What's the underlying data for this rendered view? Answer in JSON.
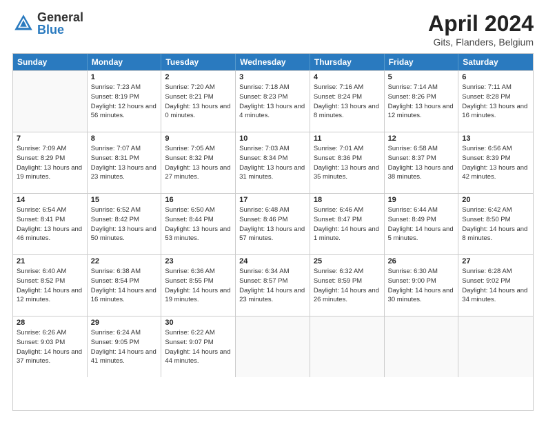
{
  "logo": {
    "general": "General",
    "blue": "Blue"
  },
  "header": {
    "month": "April 2024",
    "location": "Gits, Flanders, Belgium"
  },
  "days": [
    "Sunday",
    "Monday",
    "Tuesday",
    "Wednesday",
    "Thursday",
    "Friday",
    "Saturday"
  ],
  "weeks": [
    [
      {
        "day": "",
        "sunrise": "",
        "sunset": "",
        "daylight": ""
      },
      {
        "day": "1",
        "sunrise": "Sunrise: 7:23 AM",
        "sunset": "Sunset: 8:19 PM",
        "daylight": "Daylight: 12 hours and 56 minutes."
      },
      {
        "day": "2",
        "sunrise": "Sunrise: 7:20 AM",
        "sunset": "Sunset: 8:21 PM",
        "daylight": "Daylight: 13 hours and 0 minutes."
      },
      {
        "day": "3",
        "sunrise": "Sunrise: 7:18 AM",
        "sunset": "Sunset: 8:23 PM",
        "daylight": "Daylight: 13 hours and 4 minutes."
      },
      {
        "day": "4",
        "sunrise": "Sunrise: 7:16 AM",
        "sunset": "Sunset: 8:24 PM",
        "daylight": "Daylight: 13 hours and 8 minutes."
      },
      {
        "day": "5",
        "sunrise": "Sunrise: 7:14 AM",
        "sunset": "Sunset: 8:26 PM",
        "daylight": "Daylight: 13 hours and 12 minutes."
      },
      {
        "day": "6",
        "sunrise": "Sunrise: 7:11 AM",
        "sunset": "Sunset: 8:28 PM",
        "daylight": "Daylight: 13 hours and 16 minutes."
      }
    ],
    [
      {
        "day": "7",
        "sunrise": "Sunrise: 7:09 AM",
        "sunset": "Sunset: 8:29 PM",
        "daylight": "Daylight: 13 hours and 19 minutes."
      },
      {
        "day": "8",
        "sunrise": "Sunrise: 7:07 AM",
        "sunset": "Sunset: 8:31 PM",
        "daylight": "Daylight: 13 hours and 23 minutes."
      },
      {
        "day": "9",
        "sunrise": "Sunrise: 7:05 AM",
        "sunset": "Sunset: 8:32 PM",
        "daylight": "Daylight: 13 hours and 27 minutes."
      },
      {
        "day": "10",
        "sunrise": "Sunrise: 7:03 AM",
        "sunset": "Sunset: 8:34 PM",
        "daylight": "Daylight: 13 hours and 31 minutes."
      },
      {
        "day": "11",
        "sunrise": "Sunrise: 7:01 AM",
        "sunset": "Sunset: 8:36 PM",
        "daylight": "Daylight: 13 hours and 35 minutes."
      },
      {
        "day": "12",
        "sunrise": "Sunrise: 6:58 AM",
        "sunset": "Sunset: 8:37 PM",
        "daylight": "Daylight: 13 hours and 38 minutes."
      },
      {
        "day": "13",
        "sunrise": "Sunrise: 6:56 AM",
        "sunset": "Sunset: 8:39 PM",
        "daylight": "Daylight: 13 hours and 42 minutes."
      }
    ],
    [
      {
        "day": "14",
        "sunrise": "Sunrise: 6:54 AM",
        "sunset": "Sunset: 8:41 PM",
        "daylight": "Daylight: 13 hours and 46 minutes."
      },
      {
        "day": "15",
        "sunrise": "Sunrise: 6:52 AM",
        "sunset": "Sunset: 8:42 PM",
        "daylight": "Daylight: 13 hours and 50 minutes."
      },
      {
        "day": "16",
        "sunrise": "Sunrise: 6:50 AM",
        "sunset": "Sunset: 8:44 PM",
        "daylight": "Daylight: 13 hours and 53 minutes."
      },
      {
        "day": "17",
        "sunrise": "Sunrise: 6:48 AM",
        "sunset": "Sunset: 8:46 PM",
        "daylight": "Daylight: 13 hours and 57 minutes."
      },
      {
        "day": "18",
        "sunrise": "Sunrise: 6:46 AM",
        "sunset": "Sunset: 8:47 PM",
        "daylight": "Daylight: 14 hours and 1 minute."
      },
      {
        "day": "19",
        "sunrise": "Sunrise: 6:44 AM",
        "sunset": "Sunset: 8:49 PM",
        "daylight": "Daylight: 14 hours and 5 minutes."
      },
      {
        "day": "20",
        "sunrise": "Sunrise: 6:42 AM",
        "sunset": "Sunset: 8:50 PM",
        "daylight": "Daylight: 14 hours and 8 minutes."
      }
    ],
    [
      {
        "day": "21",
        "sunrise": "Sunrise: 6:40 AM",
        "sunset": "Sunset: 8:52 PM",
        "daylight": "Daylight: 14 hours and 12 minutes."
      },
      {
        "day": "22",
        "sunrise": "Sunrise: 6:38 AM",
        "sunset": "Sunset: 8:54 PM",
        "daylight": "Daylight: 14 hours and 16 minutes."
      },
      {
        "day": "23",
        "sunrise": "Sunrise: 6:36 AM",
        "sunset": "Sunset: 8:55 PM",
        "daylight": "Daylight: 14 hours and 19 minutes."
      },
      {
        "day": "24",
        "sunrise": "Sunrise: 6:34 AM",
        "sunset": "Sunset: 8:57 PM",
        "daylight": "Daylight: 14 hours and 23 minutes."
      },
      {
        "day": "25",
        "sunrise": "Sunrise: 6:32 AM",
        "sunset": "Sunset: 8:59 PM",
        "daylight": "Daylight: 14 hours and 26 minutes."
      },
      {
        "day": "26",
        "sunrise": "Sunrise: 6:30 AM",
        "sunset": "Sunset: 9:00 PM",
        "daylight": "Daylight: 14 hours and 30 minutes."
      },
      {
        "day": "27",
        "sunrise": "Sunrise: 6:28 AM",
        "sunset": "Sunset: 9:02 PM",
        "daylight": "Daylight: 14 hours and 34 minutes."
      }
    ],
    [
      {
        "day": "28",
        "sunrise": "Sunrise: 6:26 AM",
        "sunset": "Sunset: 9:03 PM",
        "daylight": "Daylight: 14 hours and 37 minutes."
      },
      {
        "day": "29",
        "sunrise": "Sunrise: 6:24 AM",
        "sunset": "Sunset: 9:05 PM",
        "daylight": "Daylight: 14 hours and 41 minutes."
      },
      {
        "day": "30",
        "sunrise": "Sunrise: 6:22 AM",
        "sunset": "Sunset: 9:07 PM",
        "daylight": "Daylight: 14 hours and 44 minutes."
      },
      {
        "day": "",
        "sunrise": "",
        "sunset": "",
        "daylight": ""
      },
      {
        "day": "",
        "sunrise": "",
        "sunset": "",
        "daylight": ""
      },
      {
        "day": "",
        "sunrise": "",
        "sunset": "",
        "daylight": ""
      },
      {
        "day": "",
        "sunrise": "",
        "sunset": "",
        "daylight": ""
      }
    ]
  ]
}
